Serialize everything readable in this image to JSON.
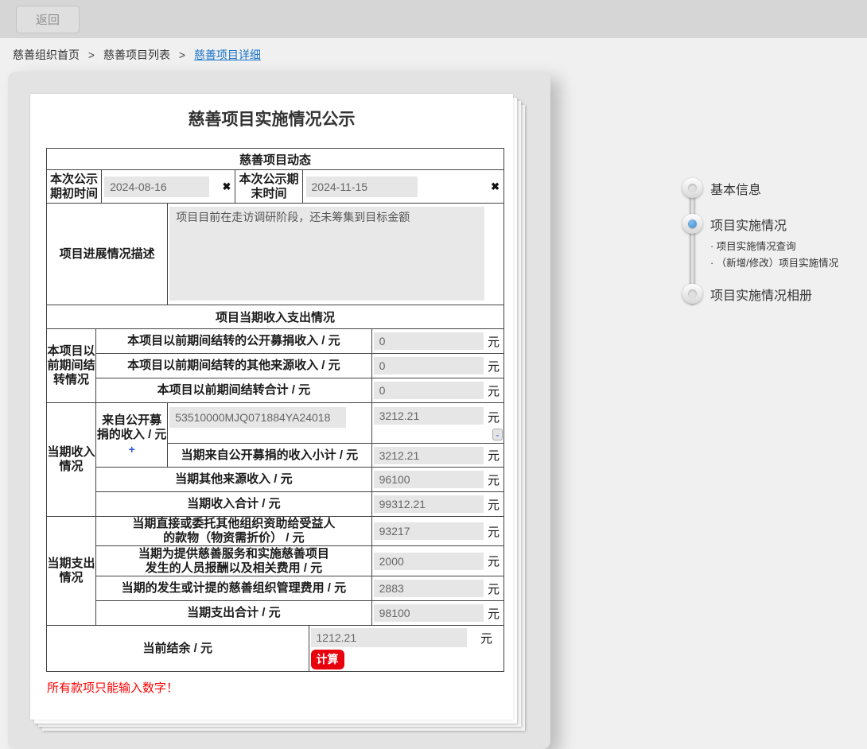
{
  "topbar": {
    "back_label": "返回"
  },
  "breadcrumb": {
    "items": [
      "慈善组织首页",
      "慈善项目列表",
      "慈善项目详细"
    ],
    "separator": ">"
  },
  "form": {
    "title": "慈善项目实施情况公示",
    "dynamics_header": "慈善项目动态",
    "period_start_label": "本次公示期初时间",
    "period_start_value": "2024-08-16",
    "period_end_label": "本次公示期末时间",
    "period_end_value": "2024-11-15",
    "clear_icon": "✖",
    "progress_label": "项目进展情况描述",
    "progress_value": "项目目前在走访调研阶段，还未筹集到目标金额",
    "finance_header": "项目当期收入支出情况",
    "unit": "元",
    "carryover": {
      "group_label": "本项目以前期间结转情况",
      "rows": [
        {
          "label": "本项目以前期间结转的公开募捐收入 / 元",
          "value": "0"
        },
        {
          "label": "本项目以前期间结转的其他来源收入 / 元",
          "value": "0"
        },
        {
          "label": "本项目以前期间结转合计 / 元",
          "value": "0"
        }
      ]
    },
    "income": {
      "group_label": "当期收入情况",
      "public_income_label": "来自公开募捐的收入 / 元",
      "add_button": "+",
      "org_code_value": "53510000MJQ071884YA24018",
      "public_income_value": "3212.21",
      "remove_button": "-",
      "subtotal_label": "当期来自公开募捐的收入小计 / 元",
      "subtotal_value": "3212.21",
      "other_label": "当期其他来源收入  / 元",
      "other_value": "96100",
      "total_label": "当期收入合计 / 元",
      "total_value": "99312.21"
    },
    "expense": {
      "group_label": "当期支出情况",
      "rows": [
        {
          "line1": "当期直接或委托其他组织资助给受益人",
          "line2": "的款物（物资需折价） / 元",
          "value": "93217"
        },
        {
          "line1": "当期为提供慈善服务和实施慈善项目",
          "line2": "发生的人员报酬以及相关费用 / 元",
          "value": "2000"
        },
        {
          "line1": "当期的发生或计提的慈善组织管理费用 / 元",
          "line2": "",
          "value": "2883"
        },
        {
          "line1": "当期支出合计 / 元",
          "line2": "",
          "value": "98100"
        }
      ]
    },
    "balance_label": "当前结余 / 元",
    "balance_value": "1212.21",
    "calc_button": "计算",
    "warning": "所有款项只能输入数字！"
  },
  "stepper": {
    "steps": [
      {
        "label": "基本信息"
      },
      {
        "label": "项目实施情况"
      },
      {
        "label": "项目实施情况相册"
      }
    ],
    "sub_items": [
      "· 项目实施情况查询",
      "· （新增/修改）项目实施情况"
    ]
  },
  "colors": {
    "accent_blue": "#3c8dd4",
    "link_blue": "#1a73c8",
    "button_red": "#e8000d",
    "warning_red": "#ff0000"
  }
}
